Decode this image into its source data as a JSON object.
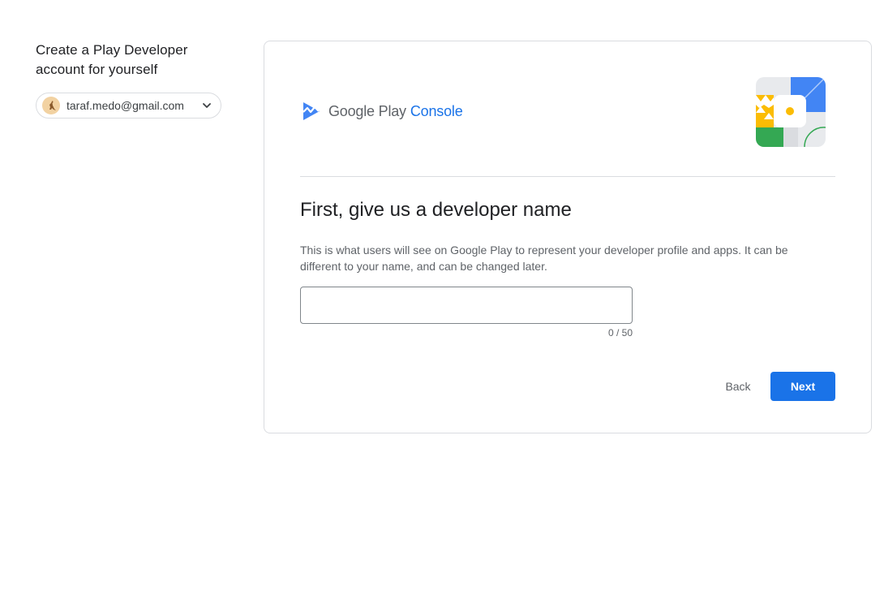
{
  "sidebar": {
    "title_line1": "Create a Play Developer",
    "title_line2": "account for yourself",
    "account": {
      "email": "taraf.medo@gmail.com",
      "avatar_icon": "kangaroo-avatar",
      "dropdown_icon": "chevron-down-icon"
    }
  },
  "card": {
    "brand": {
      "logo_icon": "play-console-logo-icon",
      "product_name": "Google Play",
      "product_suffix": "Console"
    },
    "heading": "First, give us a developer name",
    "description": "This is what users will see on Google Play to represent your developer profile and apps. It can be different to your name, and can be changed later.",
    "developer_name_input": {
      "value": "",
      "placeholder": ""
    },
    "char_count": "0 / 50",
    "back_label": "Back",
    "next_label": "Next"
  },
  "colors": {
    "accent": "#1a73e8",
    "text_primary": "#202124",
    "text_secondary": "#5f6368",
    "border": "#dadce0",
    "illustration_yellow": "#fbbc04",
    "illustration_green": "#34a853",
    "illustration_blue": "#4285f4"
  }
}
